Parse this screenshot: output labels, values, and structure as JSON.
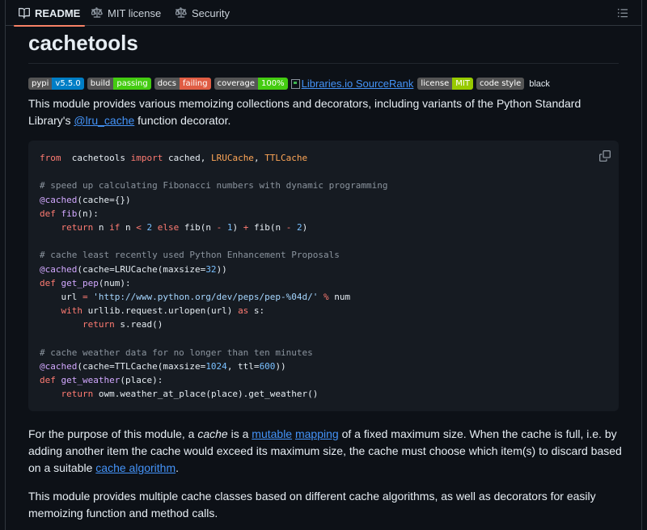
{
  "tabs": [
    {
      "label": "README",
      "active": true,
      "icon": "book-icon"
    },
    {
      "label": "MIT license",
      "active": false,
      "icon": "scale-icon"
    },
    {
      "label": "Security",
      "active": false,
      "icon": "scale-icon"
    }
  ],
  "readme": {
    "title": "cachetools",
    "badges": [
      {
        "key": "pypi",
        "value": "v5.5.0",
        "color": "#007ec6"
      },
      {
        "key": "build",
        "value": "passing",
        "color": "#4c1"
      },
      {
        "key": "docs",
        "value": "failing",
        "color": "#e05d44"
      },
      {
        "key": "coverage",
        "value": "100%",
        "color": "#4c1"
      }
    ],
    "sourcerank_alt": "Libraries.io SourceRank",
    "badges2": [
      {
        "key": "license",
        "value": "MIT",
        "color": "#97ca00"
      }
    ],
    "codestyle_key": "code style",
    "codestyle_value": "black",
    "intro_1": "This module provides various memoizing collections and decorators, including variants of the Python Standard Library's ",
    "intro_link": "@lru_cache",
    "intro_2": " function decorator.",
    "code_lines": [
      [
        [
          "kw",
          "from"
        ],
        [
          "",
          "  cachetools "
        ],
        [
          "kw",
          "import"
        ],
        [
          "",
          " cached, "
        ],
        [
          "cl",
          "LRUCache"
        ],
        [
          "",
          ", "
        ],
        [
          "cl",
          "TTLCache"
        ]
      ],
      [],
      [
        [
          "co",
          "# speed up calculating Fibonacci numbers with dynamic programming"
        ]
      ],
      [
        [
          "fn",
          "@cached"
        ],
        [
          "",
          "(cache="
        ],
        [
          "",
          "{}"
        ],
        [
          "",
          ")"
        ]
      ],
      [
        [
          "kw",
          "def"
        ],
        [
          "",
          " "
        ],
        [
          "fn",
          "fib"
        ],
        [
          "",
          "(n):"
        ]
      ],
      [
        [
          "",
          "    "
        ],
        [
          "kw",
          "return"
        ],
        [
          "",
          " n "
        ],
        [
          "kw",
          "if"
        ],
        [
          "",
          " n "
        ],
        [
          "kw",
          "<"
        ],
        [
          "",
          " "
        ],
        [
          "nu",
          "2"
        ],
        [
          "",
          " "
        ],
        [
          "kw",
          "else"
        ],
        [
          "",
          " fib(n "
        ],
        [
          "kw",
          "-"
        ],
        [
          "",
          " "
        ],
        [
          "nu",
          "1"
        ],
        [
          "",
          ") "
        ],
        [
          "kw",
          "+"
        ],
        [
          "",
          " fib(n "
        ],
        [
          "kw",
          "-"
        ],
        [
          "",
          " "
        ],
        [
          "nu",
          "2"
        ],
        [
          "",
          ")"
        ]
      ],
      [],
      [
        [
          "co",
          "# cache least recently used Python Enhancement Proposals"
        ]
      ],
      [
        [
          "fn",
          "@cached"
        ],
        [
          "",
          "(cache="
        ],
        [
          "",
          "LRUCache(maxsize="
        ],
        [
          "nu",
          "32"
        ],
        [
          "",
          "))"
        ]
      ],
      [
        [
          "kw",
          "def"
        ],
        [
          "",
          " "
        ],
        [
          "fn",
          "get_pep"
        ],
        [
          "",
          "(num):"
        ]
      ],
      [
        [
          "",
          "    url "
        ],
        [
          "kw",
          "="
        ],
        [
          "",
          " "
        ],
        [
          "st",
          "'http://www.python.org/dev/peps/pep-%04d/'"
        ],
        [
          "",
          " "
        ],
        [
          "kw",
          "%"
        ],
        [
          "",
          " num"
        ]
      ],
      [
        [
          "",
          "    "
        ],
        [
          "kw",
          "with"
        ],
        [
          "",
          " urllib.request.urlopen(url) "
        ],
        [
          "kw",
          "as"
        ],
        [
          "",
          " s:"
        ]
      ],
      [
        [
          "",
          "        "
        ],
        [
          "kw",
          "return"
        ],
        [
          "",
          " s.read()"
        ]
      ],
      [],
      [
        [
          "co",
          "# cache weather data for no longer than ten minutes"
        ]
      ],
      [
        [
          "fn",
          "@cached"
        ],
        [
          "",
          "(cache="
        ],
        [
          "",
          "TTLCache(maxsize="
        ],
        [
          "nu",
          "1024"
        ],
        [
          "",
          ", ttl="
        ],
        [
          "nu",
          "600"
        ],
        [
          "",
          "))"
        ]
      ],
      [
        [
          "kw",
          "def"
        ],
        [
          "",
          " "
        ],
        [
          "fn",
          "get_weather"
        ],
        [
          "",
          "(place):"
        ]
      ],
      [
        [
          "",
          "    "
        ],
        [
          "kw",
          "return"
        ],
        [
          "",
          " owm.weather_at_place(place).get_weather()"
        ]
      ]
    ],
    "para2": {
      "t1": "For the purpose of this module, a ",
      "em": "cache",
      "t2": " is a ",
      "link1": "mutable",
      "t3": " ",
      "link2": "mapping",
      "t4": " of a fixed maximum size. When the cache is full, i.e. by adding another item the cache would exceed its maximum size, the cache must choose which item(s) to discard based on a suitable ",
      "link3": "cache algorithm",
      "t5": "."
    },
    "para3": "This module provides multiple cache classes based on different cache algorithms, as well as decorators for easily memoizing function and method calls."
  }
}
